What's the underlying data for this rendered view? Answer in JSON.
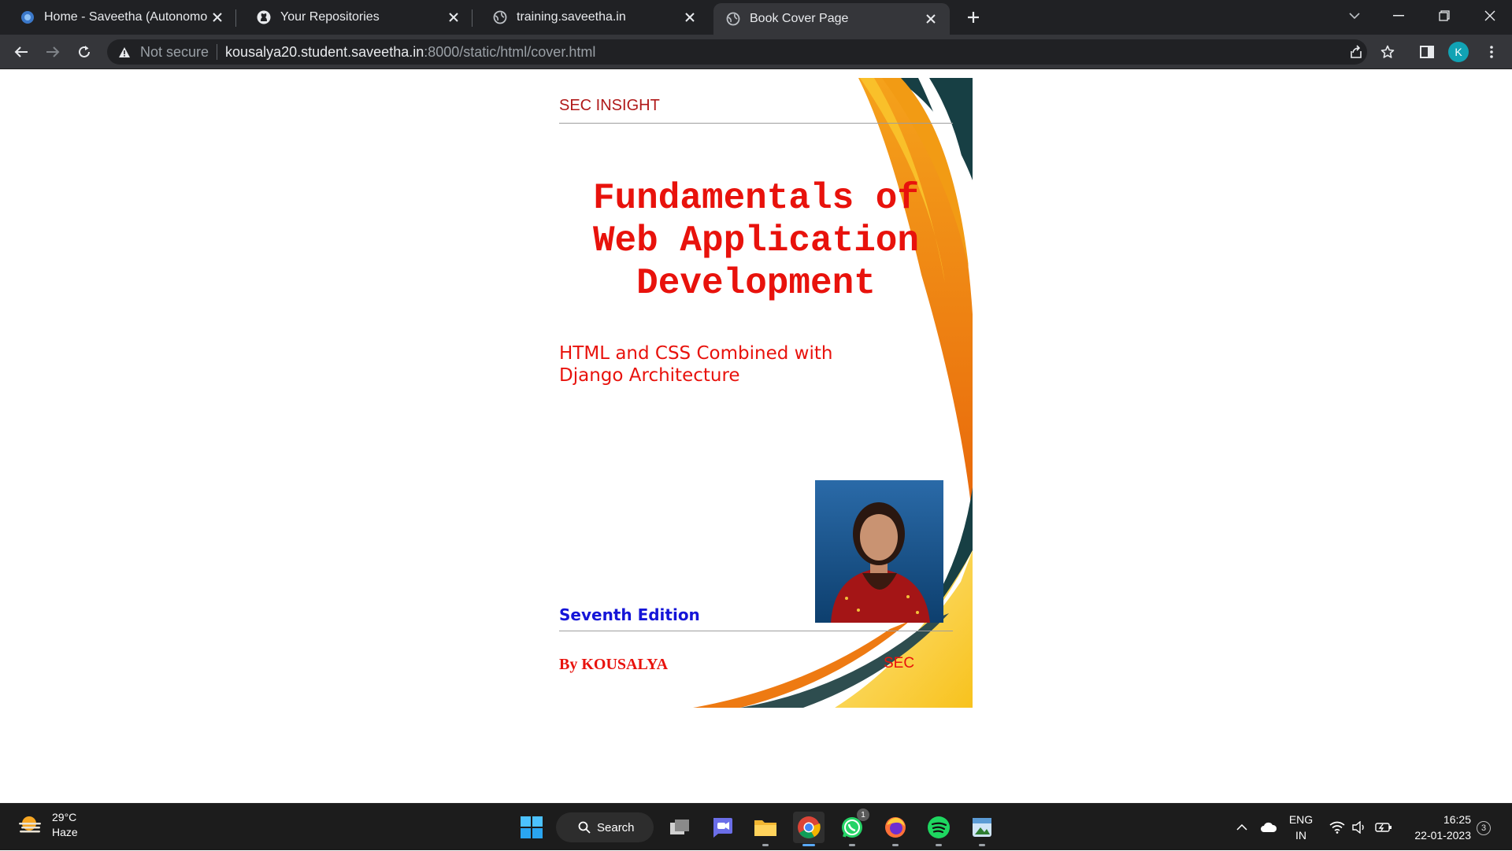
{
  "browser": {
    "tabs": [
      {
        "title": "Home - Saveetha (Autonomous)",
        "icon": "saveetha-logo-icon",
        "active": false
      },
      {
        "title": "Your Repositories",
        "icon": "github-icon",
        "active": false
      },
      {
        "title": "training.saveetha.in",
        "icon": "globe-icon",
        "active": false
      },
      {
        "title": "Book Cover Page",
        "icon": "globe-icon",
        "active": true
      }
    ],
    "address": {
      "security_label": "Not secure",
      "host": "kousalya20.student.saveetha.in",
      "path": ":8000/static/html/cover.html"
    },
    "profile_initial": "K",
    "accent": "#11a3b4"
  },
  "page": {
    "brand": "SEC INSIGHT",
    "title": "Fundamentals of Web Application Development",
    "subtitle": "HTML and CSS Combined with Django Architecture",
    "edition": "Seventh Edition",
    "author": "By KOUSALYA",
    "publisher": "SEC",
    "colors": {
      "title": "#e8120c",
      "edition": "#1515d8",
      "swoosh_orange": "#ee7a12",
      "swoosh_yellow": "#fbc531",
      "swoosh_dark": "#14383c"
    }
  },
  "taskbar": {
    "weather": {
      "temp": "29°C",
      "condition": "Haze"
    },
    "search_label": "Search",
    "whatsapp_badge": "1",
    "language": {
      "line1": "ENG",
      "line2": "IN"
    },
    "clock": {
      "time": "16:25",
      "date": "22-01-2023"
    },
    "notification_count": "3"
  }
}
